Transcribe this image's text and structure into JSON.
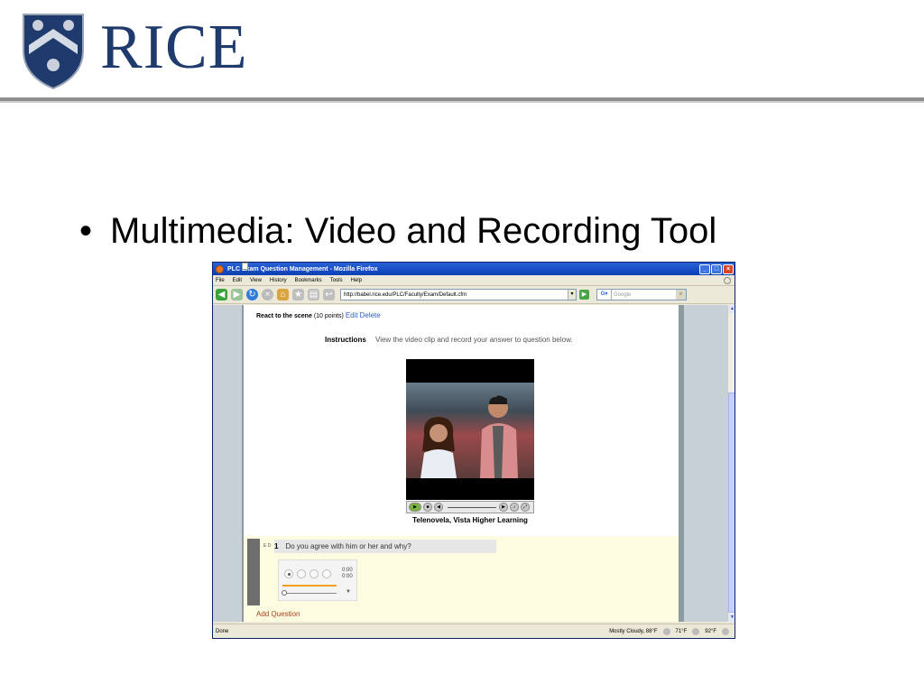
{
  "brand": {
    "name": "RICE",
    "color": "#1f3a6d"
  },
  "slide": {
    "bullet": "Multimedia: Video and Recording Tool"
  },
  "browser": {
    "window_title": "PLC Exam Question Management - Mozilla Firefox",
    "menu": [
      "File",
      "Edit",
      "View",
      "History",
      "Bookmarks",
      "Tools",
      "Help"
    ],
    "url": "http://babel.rice.edu/PLC/Faculty/Exam/Default.cfm",
    "search_placeholder": "Google",
    "page": {
      "react_title": "React to the scene",
      "react_points": "(10 points)",
      "edit_label": "Edit",
      "delete_label": "Delete",
      "instructions_label": "Instructions",
      "instructions_text": "View the video clip and record your answer to question below.",
      "video_caption": "Telenovela, Vista Higher Learning",
      "question": {
        "ed": "E D",
        "number": "1",
        "text": "Do you agree with him or her and why?"
      },
      "recorder": {
        "time_current": "0:00",
        "time_total": "0:00"
      },
      "add_question": "Add Question"
    },
    "status": {
      "left": "Done",
      "weather1": "Mostly Cloudy, 88°F",
      "weather2": "71°F",
      "weather3": "92°F"
    }
  }
}
